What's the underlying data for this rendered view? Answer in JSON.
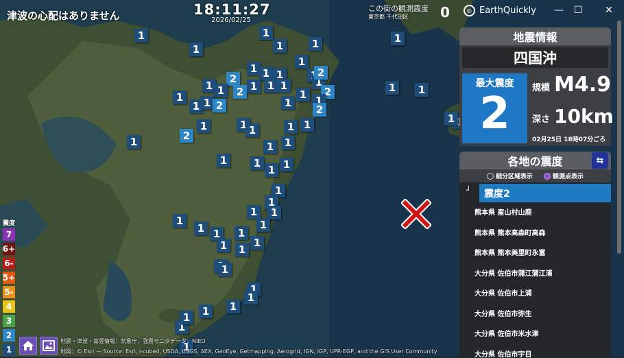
{
  "topbar": {
    "tsunami": "津波の心配はありません",
    "time": "18:11:27",
    "date": "2026/02/25",
    "local_title": "この街の観測震度",
    "local_area": "東京都 千代田区",
    "local_value": "0",
    "app_name": "EarthQuickly",
    "minimize": "—",
    "maximize": "☐",
    "close": "✕"
  },
  "quake": {
    "header": "地震情報",
    "region": "四国沖",
    "max_label": "最大震度",
    "max_value": "2",
    "mag_label": "規模",
    "mag_value": "M4.9",
    "depth_label": "深さ",
    "depth_value": "10km",
    "origin_time": "02月25日 18時07分ごろ"
  },
  "areas": {
    "header": "各地の震度",
    "mode_area": "細分区域表示",
    "mode_station": "観測点表示",
    "level_corner": "┘",
    "level_label": "震度2",
    "stations": [
      "熊本県 産山村山鹿",
      "熊本県 熊本高森町高森",
      "熊本県 熊本美里町永富",
      "大分県 佐伯市蒲江蒲江浦",
      "大分県 佐伯市上浦",
      "大分県 佐伯市弥生",
      "大分県 佐伯市米水津",
      "大分県 佐伯市宇目"
    ]
  },
  "legend": {
    "title": "震度",
    "levels": [
      {
        "label": "7",
        "color": "#8a34b4"
      },
      {
        "label": "6+",
        "color": "#6b1412"
      },
      {
        "label": "6-",
        "color": "#b3201c"
      },
      {
        "label": "5+",
        "color": "#de5a10"
      },
      {
        "label": "5-",
        "color": "#e8901c"
      },
      {
        "label": "4",
        "color": "#e7c51b"
      },
      {
        "label": "3",
        "color": "#4ca14b"
      },
      {
        "label": "2",
        "color": "#2f86c7"
      },
      {
        "label": "1",
        "color": "#1f4e7a"
      }
    ]
  },
  "attribution": {
    "line1": "地震・津波・南雲情報：気象庁，強震モニタデータ：NIED",
    "line2": "地図：© Esri — Source: Esri, i-cubed, USDA, USGS, AEX, GeoEye, Getmapping, Aerogrid, IGN, IGP, UPR-EGP, and the GIS User Community"
  },
  "icons": {
    "home": "home-icon",
    "image": "image-icon",
    "swap": "swap-icon",
    "epicenter": "epicenter-x-icon"
  },
  "markers": [
    {
      "v": "1"
    },
    {
      "v": "1"
    },
    {
      "v": "1"
    },
    {
      "v": "1"
    },
    {
      "v": "1"
    },
    {
      "v": "1"
    },
    {
      "v": "1"
    },
    {
      "v": "1"
    },
    {
      "v": "2"
    },
    {
      "v": "1"
    },
    {
      "v": "1"
    },
    {
      "v": "1"
    },
    {
      "v": "1"
    },
    {
      "v": "1"
    },
    {
      "v": "2"
    },
    {
      "v": "1"
    },
    {
      "v": "1"
    },
    {
      "v": "1"
    },
    {
      "v": "1"
    },
    {
      "v": "2"
    },
    {
      "v": "2"
    },
    {
      "v": "1"
    },
    {
      "v": "1"
    },
    {
      "v": "1"
    },
    {
      "v": "1"
    },
    {
      "v": "2"
    },
    {
      "v": "1"
    },
    {
      "v": "1"
    },
    {
      "v": "1"
    },
    {
      "v": "1"
    },
    {
      "v": "1"
    },
    {
      "v": "1"
    },
    {
      "v": "2"
    },
    {
      "v": "1"
    },
    {
      "v": "2"
    },
    {
      "v": "1"
    },
    {
      "v": "1"
    },
    {
      "v": "1"
    },
    {
      "v": "1"
    },
    {
      "v": "1"
    },
    {
      "v": "1"
    },
    {
      "v": "1"
    },
    {
      "v": "1"
    },
    {
      "v": "1"
    },
    {
      "v": "1"
    },
    {
      "v": "1"
    },
    {
      "v": "1"
    },
    {
      "v": "1"
    },
    {
      "v": "1"
    },
    {
      "v": "1"
    },
    {
      "v": "1"
    },
    {
      "v": "1"
    },
    {
      "v": "1"
    },
    {
      "v": "1"
    },
    {
      "v": "1"
    },
    {
      "v": "1"
    },
    {
      "v": "1"
    },
    {
      "v": "1"
    },
    {
      "v": "1"
    },
    {
      "v": "1"
    },
    {
      "v": "1"
    },
    {
      "v": "1"
    },
    {
      "v": "1"
    },
    {
      "v": "1"
    },
    {
      "v": "1"
    },
    {
      "v": "1"
    },
    {
      "v": "1"
    }
  ]
}
